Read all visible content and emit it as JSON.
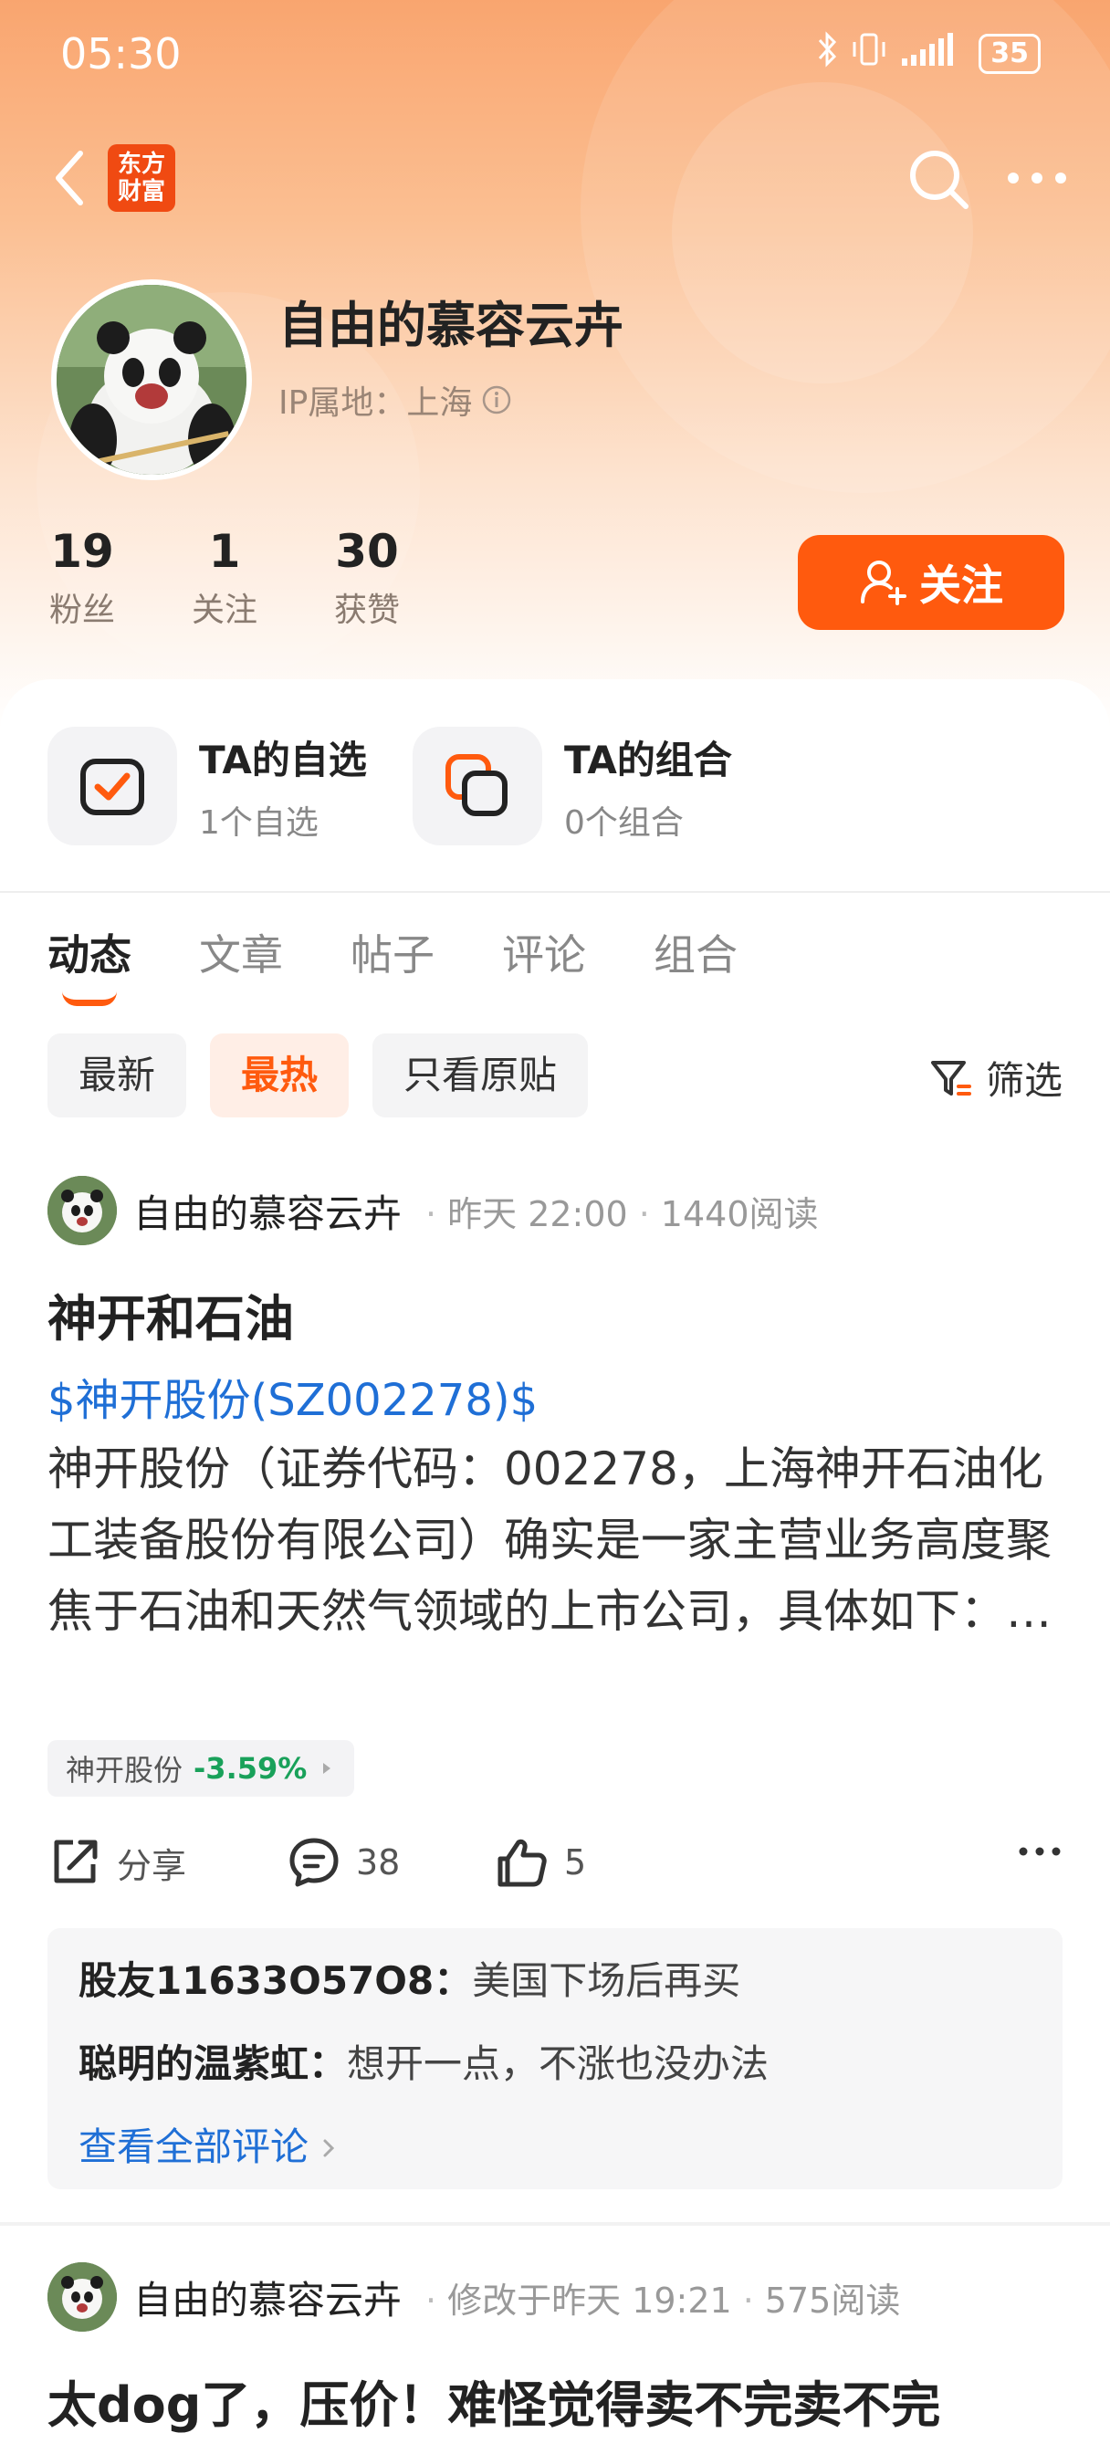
{
  "status_bar": {
    "time": "05:30",
    "battery": "35"
  },
  "nav": {
    "logo_line1": "东方",
    "logo_line2": "财富"
  },
  "profile": {
    "name": "自由的慕容云卉",
    "ip_label": "IP属地：上海",
    "stats": [
      {
        "num": "19",
        "label": "粉丝"
      },
      {
        "num": "1",
        "label": "关注"
      },
      {
        "num": "30",
        "label": "获赞"
      }
    ],
    "follow_label": "关注"
  },
  "quick_links": [
    {
      "title": "TA的自选",
      "sub": "1个自选"
    },
    {
      "title": "TA的组合",
      "sub": "0个组合"
    }
  ],
  "tabs": [
    "动态",
    "文章",
    "帖子",
    "评论",
    "组合"
  ],
  "filters": [
    "最新",
    "最热",
    "只看原贴"
  ],
  "filter_label": "筛选",
  "post1": {
    "author": "自由的慕容云卉",
    "time": "昨天 22:00",
    "reads": "1440阅读",
    "title": "神开和石油",
    "stock_link": "$神开股份(SZ002278)$",
    "body": "神开股份（证券代码：002278，上海神开石油化工装备股份有限公司）确实是一家主营业务高度聚焦于石油和天然气领域的上市公司，具体如下：…",
    "stock_tag_name": "神开股份",
    "stock_tag_change": "-3.59%",
    "share_label": "分享",
    "comment_count": "38",
    "like_count": "5",
    "comments": [
      {
        "user": "股友11633O57O8：",
        "text": "美国下场后再买"
      },
      {
        "user": "聪明的温紫虹：",
        "text": "想开一点，不涨也没办法"
      }
    ],
    "see_all": "查看全部评论"
  },
  "post2": {
    "author": "自由的慕容云卉",
    "time": "修改于昨天 19:21",
    "reads": "575阅读",
    "title": "太dog了，压价！难怪觉得卖不完卖不完"
  },
  "colors": {
    "accent": "#ff5a0e",
    "link": "#1f6fd6",
    "down": "#19a15a"
  }
}
